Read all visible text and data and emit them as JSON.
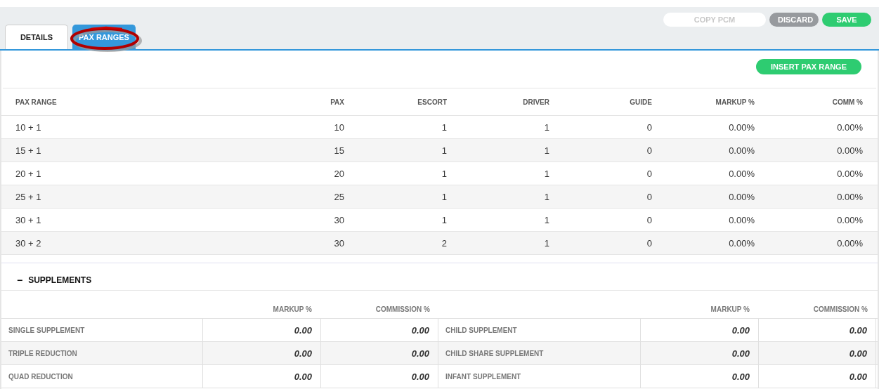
{
  "tabs": [
    {
      "label": "DETAILS",
      "selected": false
    },
    {
      "label": "PAX RANGES",
      "selected": true
    }
  ],
  "actions": [
    {
      "label": "COPY PCM",
      "kind": "disabled"
    },
    {
      "label": "DISCARD",
      "kind": "secondary"
    },
    {
      "label": "SAVE",
      "kind": "primary"
    }
  ],
  "insert_button": "INSERT PAX RANGE",
  "table": {
    "columns": [
      "PAX RANGE",
      "PAX",
      "ESCORT",
      "DRIVER",
      "GUIDE",
      "MARKUP %",
      "COMM %"
    ],
    "rows": [
      [
        "10 + 1",
        "10",
        "1",
        "1",
        "0",
        "0.00%",
        "0.00%"
      ],
      [
        "15 + 1",
        "15",
        "1",
        "1",
        "0",
        "0.00%",
        "0.00%"
      ],
      [
        "20 + 1",
        "20",
        "1",
        "1",
        "0",
        "0.00%",
        "0.00%"
      ],
      [
        "25 + 1",
        "25",
        "1",
        "1",
        "0",
        "0.00%",
        "0.00%"
      ],
      [
        "30 + 1",
        "30",
        "1",
        "1",
        "0",
        "0.00%",
        "0.00%"
      ],
      [
        "30 + 2",
        "30",
        "2",
        "1",
        "0",
        "0.00%",
        "0.00%"
      ]
    ]
  },
  "supplements": {
    "title": "SUPPLEMENTS",
    "expanded": true,
    "collapse_glyph": "−",
    "columns": [
      "",
      "MARKUP %",
      "COMMISSION %",
      "",
      "MARKUP %",
      "COMMISSION %"
    ],
    "rows": [
      [
        "SINGLE SUPPLEMENT",
        "0.00",
        "0.00",
        "CHILD SUPPLEMENT",
        "0.00",
        "0.00"
      ],
      [
        "TRIPLE REDUCTION",
        "0.00",
        "0.00",
        "CHILD SHARE SUPPLEMENT",
        "0.00",
        "0.00"
      ],
      [
        "QUAD REDUCTION",
        "0.00",
        "0.00",
        "INFANT SUPPLEMENT",
        "0.00",
        "0.00"
      ]
    ]
  }
}
